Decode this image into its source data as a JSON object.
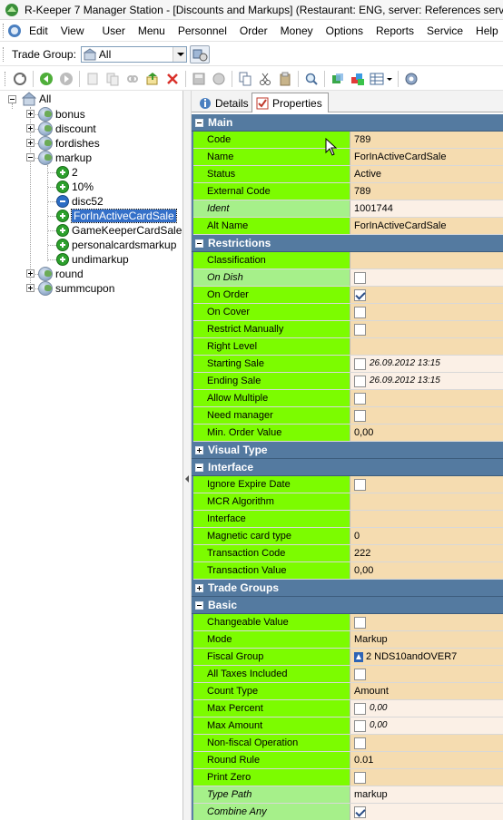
{
  "window": {
    "title": "R-Keeper 7 Manager Station - [Discounts and Markups] (Restaurant: ENG, server: References server)"
  },
  "menu": {
    "items": [
      "Edit",
      "View",
      "User",
      "Menu",
      "Personnel",
      "Order",
      "Money",
      "Options",
      "Reports",
      "Service",
      "Help"
    ]
  },
  "tradebar": {
    "label": "Trade Group:",
    "selected": "All"
  },
  "toolbar": {
    "icons": [
      "refresh-icon",
      "back-icon",
      "forward-icon",
      "new-icon",
      "copy-item-icon",
      "link-icon",
      "export-icon",
      "delete-icon",
      "save-icon",
      "cancel-icon",
      "copy-icon",
      "cut-icon",
      "paste-icon",
      "find-icon",
      "filter-icon",
      "colors-icon",
      "view-icon",
      "settings-icon"
    ]
  },
  "tree": {
    "root": "All",
    "groups": [
      "bonus",
      "discount",
      "fordishes",
      "markup",
      "round",
      "summcupon"
    ],
    "markup_children": [
      {
        "label": "2",
        "icon": "plus"
      },
      {
        "label": "10%",
        "icon": "plus"
      },
      {
        "label": "disc52",
        "icon": "minus"
      },
      {
        "label": "ForInActiveCardSale",
        "icon": "plus",
        "selected": true
      },
      {
        "label": "GameKeeperCardSale",
        "icon": "plus"
      },
      {
        "label": "personalcardsmarkup",
        "icon": "plus"
      },
      {
        "label": "undimarkup",
        "icon": "plus"
      }
    ]
  },
  "tabs": [
    "Details",
    "Properties"
  ],
  "properties": [
    {
      "type": "section",
      "title": "Main",
      "expanded": true
    },
    {
      "name": "Code",
      "value": "789"
    },
    {
      "name": "Name",
      "value": "ForInActiveCardSale"
    },
    {
      "name": "Status",
      "value": "Active"
    },
    {
      "name": "External Code",
      "value": "789"
    },
    {
      "name": "Ident",
      "value": "1001744",
      "readonly": true
    },
    {
      "name": "Alt Name",
      "value": "ForInActiveCardSale"
    },
    {
      "type": "section",
      "title": "Restrictions",
      "expanded": true
    },
    {
      "name": "Classification",
      "value": ""
    },
    {
      "name": "On Dish",
      "check": false,
      "readonly": true
    },
    {
      "name": "On Order",
      "check": true
    },
    {
      "name": "On Cover",
      "check": false
    },
    {
      "name": "Restrict Manually",
      "check": false
    },
    {
      "name": "Right Level",
      "value": ""
    },
    {
      "name": "Starting Sale",
      "check": false,
      "value": "26.09.2012 13:15",
      "dt": true
    },
    {
      "name": "Ending Sale",
      "check": false,
      "value": "26.09.2012 13:15",
      "dt": true
    },
    {
      "name": "Allow Multiple",
      "check": false
    },
    {
      "name": "Need manager",
      "check": false
    },
    {
      "name": "Min. Order Value",
      "value": "0,00"
    },
    {
      "type": "section",
      "title": "Visual Type",
      "expanded": false
    },
    {
      "type": "section",
      "title": "Interface",
      "expanded": true
    },
    {
      "name": "Ignore Expire Date",
      "check": false
    },
    {
      "name": "MCR Algorithm",
      "value": ""
    },
    {
      "name": "Interface",
      "value": ""
    },
    {
      "name": "Magnetic card type",
      "value": "0"
    },
    {
      "name": "Transaction Code",
      "value": "222"
    },
    {
      "name": "Transaction Value",
      "value": "0,00"
    },
    {
      "type": "section",
      "title": "Trade Groups",
      "expanded": false
    },
    {
      "type": "section",
      "title": "Basic",
      "expanded": true
    },
    {
      "name": "Changeable Value",
      "check": false
    },
    {
      "name": "Mode",
      "value": "Markup"
    },
    {
      "name": "Fiscal Group",
      "value": "2 NDS10andOVER7",
      "fiscal": true
    },
    {
      "name": "All Taxes Included",
      "check": false
    },
    {
      "name": "Count Type",
      "value": "Amount"
    },
    {
      "name": "Max Percent",
      "check": false,
      "value": "0,00",
      "dt": true
    },
    {
      "name": "Max Amount",
      "check": false,
      "value": "0,00",
      "dt": true
    },
    {
      "name": "Non-fiscal Operation",
      "check": false
    },
    {
      "name": "Round Rule",
      "value": "0.01"
    },
    {
      "name": "Print Zero",
      "check": false
    },
    {
      "name": "Type Path",
      "value": "markup",
      "readonly": true
    },
    {
      "name": "Combine Any",
      "check": true,
      "readonly": true
    }
  ],
  "colors": {
    "name_cell": "#7cfc00",
    "value_cell": "#f5dcb0",
    "section_header": "#547aa0",
    "selection": "#3470c9"
  }
}
